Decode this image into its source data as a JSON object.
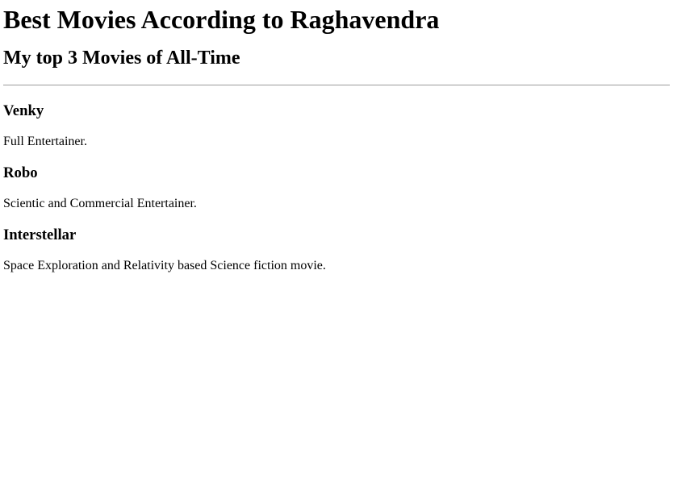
{
  "page": {
    "title": "Best Movies According to Raghavendra",
    "subtitle": "My top 3 Movies of All-Time"
  },
  "movies": [
    {
      "name": "Venky",
      "description": "Full Entertainer."
    },
    {
      "name": "Robo",
      "description": "Scientic and Commercial Entertainer."
    },
    {
      "name": "Interstellar",
      "description": "Space Exploration and Relativity based Science fiction movie."
    }
  ]
}
